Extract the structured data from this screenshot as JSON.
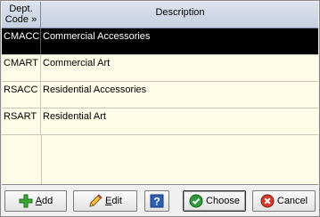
{
  "grid": {
    "header": {
      "code_line1": "Dept.",
      "code_line2": "Code »",
      "description": "Description"
    },
    "rows": [
      {
        "code": "CMACC",
        "description": "Commercial Accessories",
        "selected": true
      },
      {
        "code": "CMART",
        "description": "Commercial Art",
        "selected": false
      },
      {
        "code": "RSACC",
        "description": "Residential Accessories",
        "selected": false
      },
      {
        "code": "RSART",
        "description": "Residential Art",
        "selected": false
      }
    ]
  },
  "toolbar": {
    "add": {
      "underline": "A",
      "rest": "dd",
      "icon": "plus-icon"
    },
    "edit": {
      "underline": "E",
      "rest": "dit",
      "icon": "pencil-icon"
    },
    "help": {
      "icon": "help-icon",
      "glyph": "?"
    },
    "choose": {
      "label": "Choose",
      "icon": "check-circle-icon"
    },
    "cancel": {
      "label": "Cancel",
      "icon": "x-circle-icon"
    }
  }
}
